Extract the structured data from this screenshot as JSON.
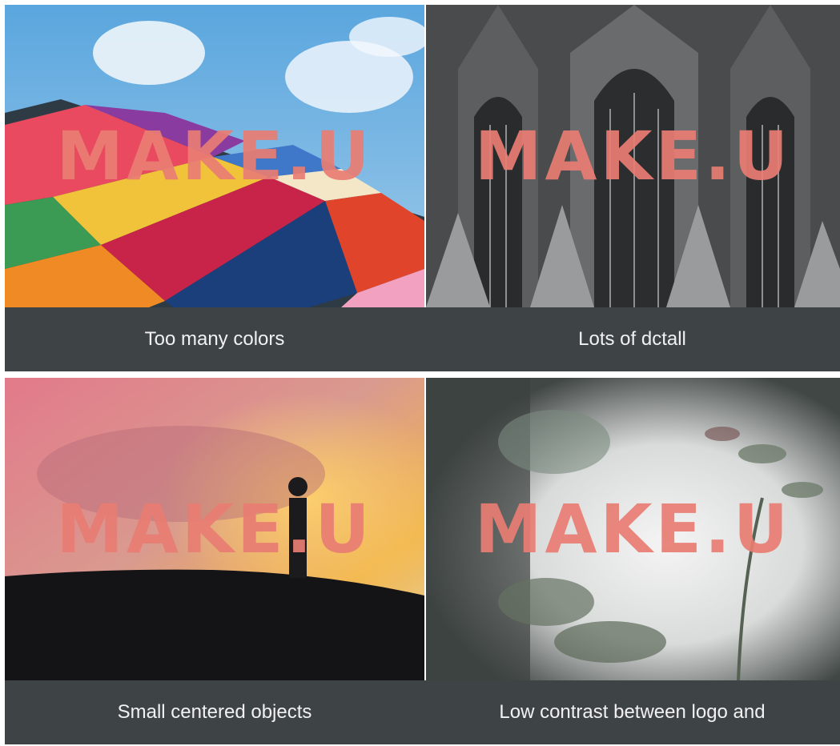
{
  "logo_text": "MAKE.U",
  "accent_color": "#e97d73",
  "caption_bg": "#3e4446",
  "tiles": [
    {
      "caption": "Too many colors",
      "image": "colorful-building-photo"
    },
    {
      "caption": "Lots of dctall",
      "image": "cathedral-facade-photo"
    },
    {
      "caption": "Small centered objects",
      "image": "silhouette-sunset-photo"
    },
    {
      "caption": "Low contrast between logo and",
      "image": "blurred-plant-photo"
    }
  ]
}
